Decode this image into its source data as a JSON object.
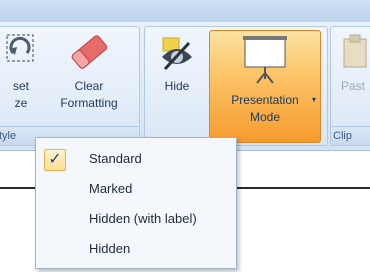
{
  "ribbon": {
    "styles_group": {
      "reset_label_1": "set",
      "reset_label_2": "ze",
      "clear_label_1": "Clear",
      "clear_label_2": "Formatting",
      "group_label": "tyle"
    },
    "hide_label": "Hide",
    "presentation_label_1": "Presentation",
    "presentation_label_2": "Mode",
    "paste_label": "Past",
    "clipboard_group_label": "Clip"
  },
  "dropdown": {
    "items": [
      {
        "label": "Standard",
        "checked": true
      },
      {
        "label": "Marked",
        "checked": false
      },
      {
        "label": "Hidden (with label)",
        "checked": false
      },
      {
        "label": "Hidden",
        "checked": false
      }
    ]
  },
  "colors": {
    "accent_orange": "#f59b2e",
    "ribbon_blue": "#dde9f7",
    "check_blue": "#1f3f8c"
  }
}
